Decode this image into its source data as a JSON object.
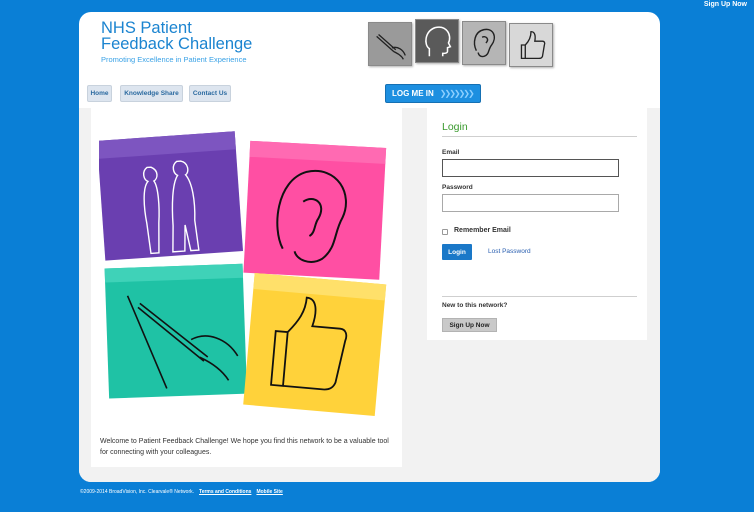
{
  "topbar": {
    "signup_link": "Sign Up Now"
  },
  "header": {
    "title_line1": "NHS Patient",
    "title_line2": "Feedback Challenge",
    "tagline": "Promoting Excellence in Patient Experience",
    "tile_icons": [
      "writing-hand-icon",
      "head-silhouette-icon",
      "ear-icon",
      "thumbs-up-icon"
    ]
  },
  "nav": {
    "items": [
      {
        "label": "Home"
      },
      {
        "label": "Knowledge Share"
      },
      {
        "label": "Contact Us"
      }
    ],
    "login_cta": "LOG ME IN"
  },
  "welcome_text": "Welcome to Patient Feedback Challenge! We hope you find this network to be a valuable tool for connecting with your colleagues.",
  "collage": {
    "notes": [
      {
        "icon": "people-silhouettes-icon",
        "color": "#6a3fb0"
      },
      {
        "icon": "ear-icon",
        "color": "#ff4fa3"
      },
      {
        "icon": "writing-hand-icon",
        "color": "#1fc2a5"
      },
      {
        "icon": "thumbs-up-icon",
        "color": "#ffd23a"
      }
    ]
  },
  "login": {
    "heading": "Login",
    "email_label": "Email",
    "email_value": "",
    "password_label": "Password",
    "password_value": "",
    "remember_label": "Remember Email",
    "login_button": "Login",
    "lost_password": "Lost Password",
    "new_prompt": "New to this network?",
    "signup_button": "Sign Up Now"
  },
  "footer": {
    "copyright": "©2009-2014 BroadVision, Inc.  Clearvale® Network.",
    "terms": "Terms and Conditions",
    "mobile": "Mobile Site"
  },
  "colors": {
    "background": "#0a7fd6",
    "brand_blue": "#1b84d0",
    "login_green": "#3a9a2e"
  }
}
